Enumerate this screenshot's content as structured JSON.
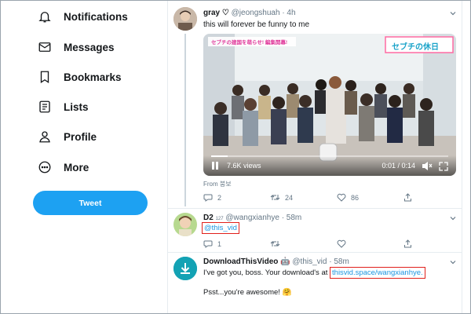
{
  "sidebar": {
    "items": [
      {
        "label": "Notifications",
        "icon": "bell-icon"
      },
      {
        "label": "Messages",
        "icon": "envelope-icon"
      },
      {
        "label": "Bookmarks",
        "icon": "bookmark-icon"
      },
      {
        "label": "Lists",
        "icon": "list-icon"
      },
      {
        "label": "Profile",
        "icon": "person-icon"
      },
      {
        "label": "More",
        "icon": "more-circle-icon"
      }
    ],
    "tweet_button": "Tweet"
  },
  "tweets": [
    {
      "name": "gray",
      "name_suffix": "♡",
      "handle": "@jeongshuah",
      "time": "· 4h",
      "text": "this will forever be funny to me",
      "video": {
        "banner_left": "セブチの建国を萌らせ! 編集開幕!",
        "banner_right": "セブチの休日",
        "views": "7.6K views",
        "time": "0:01 / 0:14",
        "progress": 0.07
      },
      "source_label": "From 붕보",
      "replies": "2",
      "retweets": "24",
      "likes": "86"
    },
    {
      "name": "D2",
      "name_suffix": "127",
      "handle": "@wangxianhye",
      "time": "· 58m",
      "text": "@this_vid",
      "replies": "1"
    },
    {
      "name": "DownloadThisVideo",
      "name_suffix": "🤖",
      "handle": "@this_vid",
      "time": "· 58m",
      "text_prefix": "I've got you, boss. Your download's at ",
      "link": "thisvid.space/wangxianhye.",
      "text2": "Psst...you're awesome! 🤗"
    }
  ],
  "colors": {
    "accent": "#1da1f2",
    "link": "#1b95e0",
    "highlight_box": "#e0201b",
    "muted": "#657786"
  }
}
